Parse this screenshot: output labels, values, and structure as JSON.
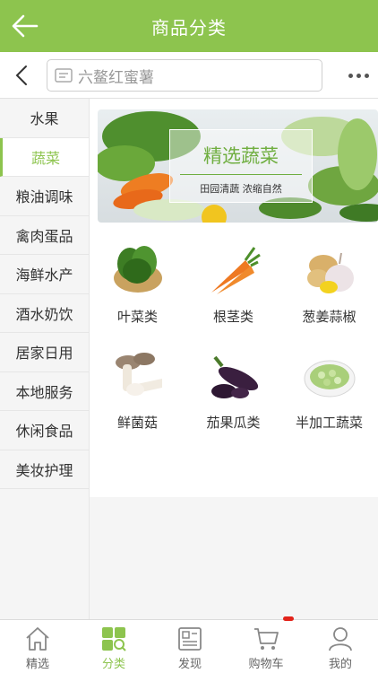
{
  "header": {
    "title": "商品分类",
    "back_icon": "arrow-left-icon"
  },
  "search": {
    "placeholder": "六鳌红蜜薯",
    "more_icon": "more-dots-icon"
  },
  "sidebar": {
    "items": [
      {
        "label": "水果"
      },
      {
        "label": "蔬菜",
        "active": true
      },
      {
        "label": "粮油调味"
      },
      {
        "label": "禽肉蛋品"
      },
      {
        "label": "海鲜水产"
      },
      {
        "label": "酒水奶饮"
      },
      {
        "label": "居家日用"
      },
      {
        "label": "本地服务"
      },
      {
        "label": "休闲食品"
      },
      {
        "label": "美妆护理"
      }
    ]
  },
  "banner": {
    "headline": "精选蔬菜",
    "subtitle": "田园清蔬  浓缩自然"
  },
  "categories": [
    {
      "label": "叶菜类",
      "icon": "leafy-greens-icon"
    },
    {
      "label": "根茎类",
      "icon": "carrot-icon"
    },
    {
      "label": "葱姜蒜椒",
      "icon": "ginger-garlic-icon"
    },
    {
      "label": "鲜菌菇",
      "icon": "mushroom-icon"
    },
    {
      "label": "茄果瓜类",
      "icon": "eggplant-icon"
    },
    {
      "label": "半加工蔬菜",
      "icon": "cut-vegetables-icon"
    }
  ],
  "tabbar": {
    "items": [
      {
        "label": "精选",
        "icon": "home-icon"
      },
      {
        "label": "分类",
        "icon": "category-grid-icon",
        "active": true
      },
      {
        "label": "发现",
        "icon": "discover-icon"
      },
      {
        "label": "购物车",
        "icon": "cart-icon"
      },
      {
        "label": "我的",
        "icon": "user-icon"
      }
    ]
  },
  "colors": {
    "accent": "#8dc44e",
    "badge": "#e2231a"
  }
}
